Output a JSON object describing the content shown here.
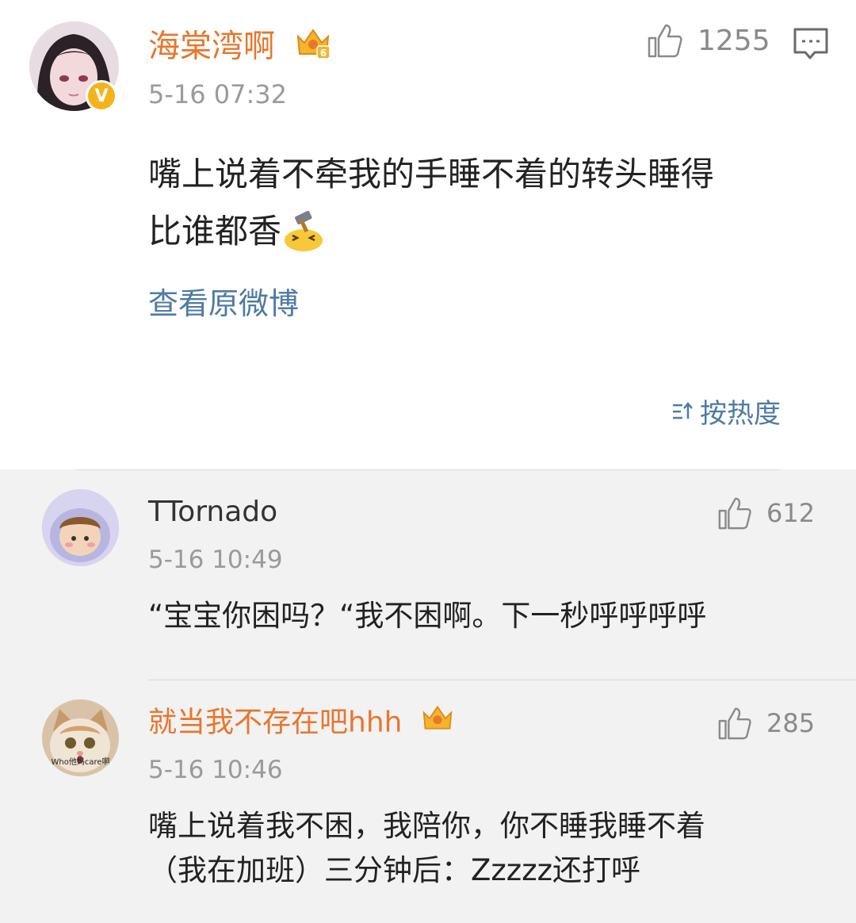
{
  "post": {
    "username": "海棠湾啊",
    "time": "5-16 07:32",
    "likes": "1255",
    "text_line1": "嘴上说着不牵我的手睡不着的转头睡得",
    "text_line2": "比谁都香",
    "emoji": "hammer-face-emoji",
    "verified_badge": "V",
    "view_original": "查看原微博",
    "crown_level": "6"
  },
  "sort": {
    "label": "按热度",
    "icon": "sort-icon"
  },
  "comments": [
    {
      "username": "TTornado",
      "time": "5-16 10:49",
      "likes": "612",
      "text_line1": "“宝宝你困吗？“我不困啊。下一秒呼呼呼呼"
    },
    {
      "username": "就当我不存在吧hhh",
      "time": "5-16 10:46",
      "likes": "285",
      "text_line1": "嘴上说着我不困，我陪你，你不睡我睡不着",
      "text_line2": "（我在加班）三分钟后：Zzzzz还打呼",
      "avatar_caption": "Who他妈care啊"
    }
  ],
  "colors": {
    "vip_name": "#e8762d",
    "link": "#4e7aa6",
    "background": "#f2f2f2"
  }
}
